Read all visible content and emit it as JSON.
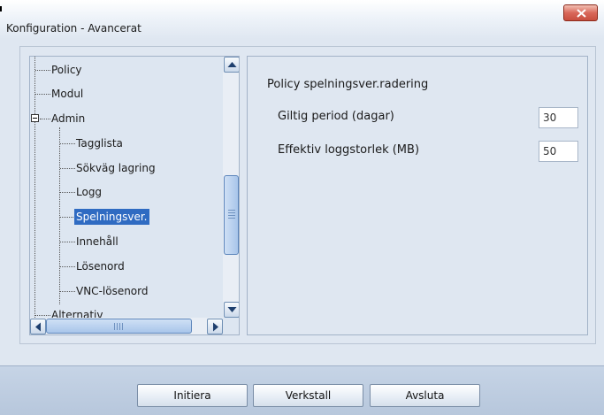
{
  "window": {
    "title": "Konfiguration - Avancerat"
  },
  "tree": {
    "items": [
      {
        "label": "Policy"
      },
      {
        "label": "Modul"
      },
      {
        "label": "Admin"
      },
      {
        "label": "Tagglista"
      },
      {
        "label": "Sökväg lagring"
      },
      {
        "label": "Logg"
      },
      {
        "label": "Spelningsver."
      },
      {
        "label": "Innehåll"
      },
      {
        "label": "Lösenord"
      },
      {
        "label": "VNC-lösenord"
      },
      {
        "label": "Alternativ"
      }
    ],
    "selected": "Spelningsver."
  },
  "settings": {
    "heading": "Policy spelningsver.radering",
    "fields": [
      {
        "label": "Giltig period (dagar)",
        "value": "30"
      },
      {
        "label": "Effektiv loggstorlek (MB)",
        "value": "50"
      }
    ]
  },
  "footer": {
    "buttons": [
      "Initiera",
      "Verkstall",
      "Avsluta"
    ]
  },
  "colors": {
    "selection": "#2f6bc2",
    "close_button": "#c84e3f",
    "panel_background": "#dfe7f1"
  }
}
